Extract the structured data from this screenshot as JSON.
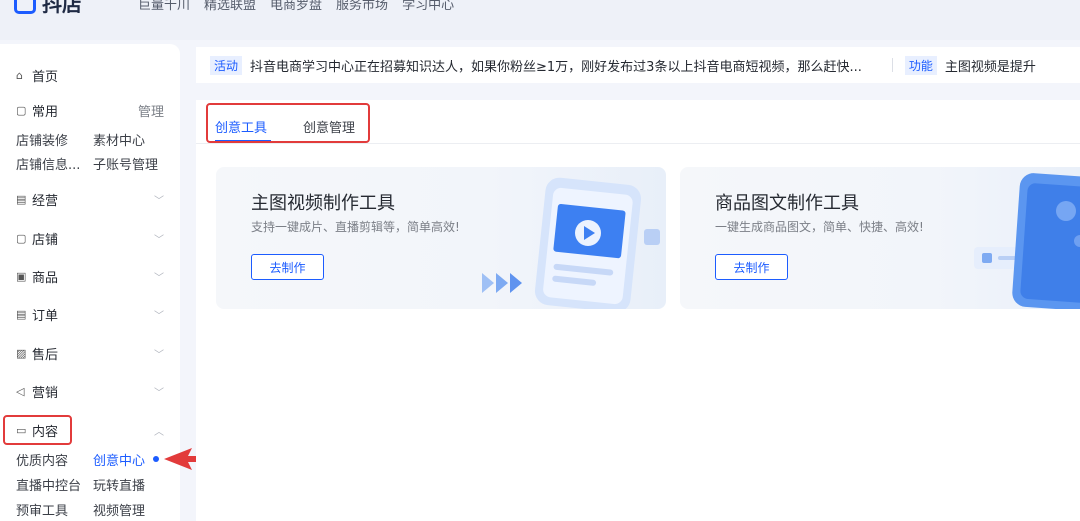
{
  "topbar": {
    "logo_text": "抖店",
    "nav": [
      "巨量千川",
      "精选联盟",
      "电商罗盘",
      "服务市场",
      "学习中心"
    ]
  },
  "sidebar": {
    "home": "首页",
    "common": {
      "label": "常用",
      "manage": "管理"
    },
    "common_items": [
      "店铺装修",
      "素材中心",
      "店铺信息...",
      "子账号管理"
    ],
    "sections": [
      "经营",
      "店铺",
      "商品",
      "订单",
      "售后",
      "营销"
    ],
    "content": {
      "label": "内容"
    },
    "content_items": [
      "优质内容",
      "创意中心",
      "直播中控台",
      "玩转直播",
      "预审工具",
      "视频管理"
    ],
    "active_item": "创意中心"
  },
  "notice": {
    "tag1": "活动",
    "text1": "抖音电商学习中心正在招募知识达人，如果你粉丝≥1万，刚好发布过3条以上抖音电商短视频，那么赶快...",
    "tag2": "功能",
    "text2": "主图视频是提升"
  },
  "tabs": [
    {
      "label": "创意工具",
      "active": true
    },
    {
      "label": "创意管理",
      "active": false
    }
  ],
  "cards": [
    {
      "title": "主图视频制作工具",
      "desc": "支持一键成片、直播剪辑等，简单高效!",
      "button": "去制作"
    },
    {
      "title": "商品图文制作工具",
      "desc": "一键生成商品图文，简单、快捷、高效!",
      "button": "去制作"
    }
  ],
  "colors": {
    "accent": "#1c5cff",
    "highlight": "#e23b3b"
  }
}
